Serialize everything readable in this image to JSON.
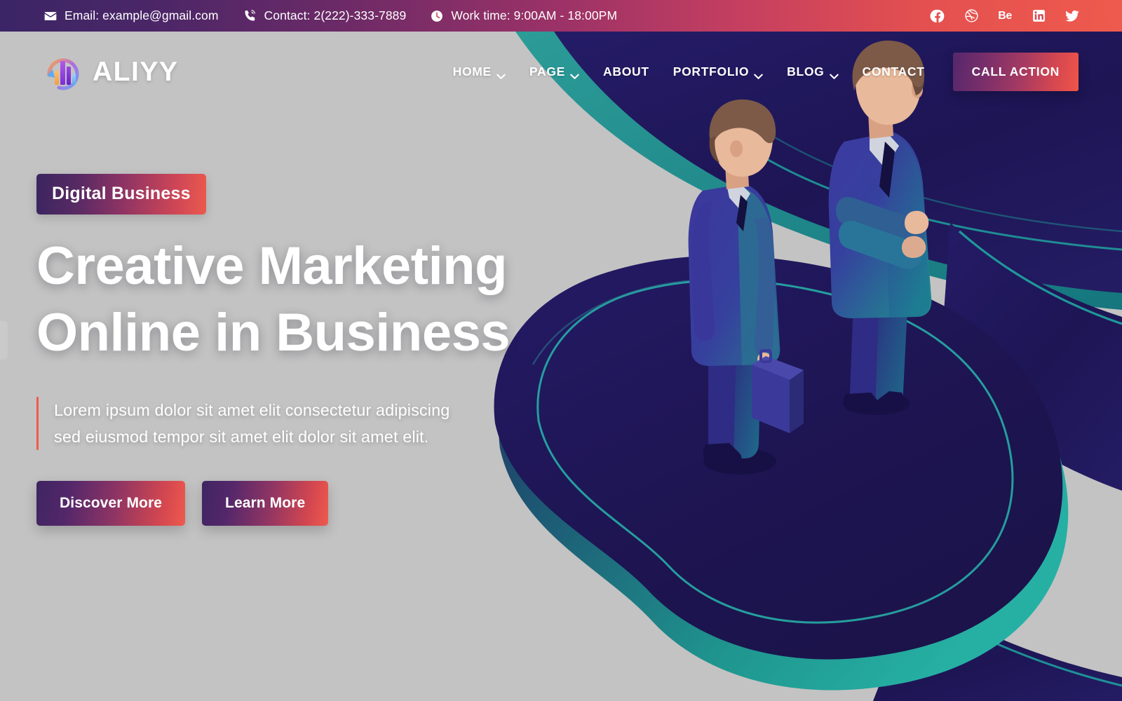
{
  "topbar": {
    "email": {
      "icon": "envelope-icon",
      "text": "Email: example@gmail.com"
    },
    "contact": {
      "icon": "phone-icon",
      "text": "Contact: 2(222)-333-7889"
    },
    "worktime": {
      "icon": "clock-icon",
      "text": "Work time: 9:00AM - 18:00PM"
    },
    "socials": [
      {
        "name": "facebook-icon",
        "label": "Facebook"
      },
      {
        "name": "dribbble-icon",
        "label": "Dribbble"
      },
      {
        "name": "behance-icon",
        "label": "Be"
      },
      {
        "name": "linkedin-icon",
        "label": "in"
      },
      {
        "name": "twitter-icon",
        "label": "Twitter"
      }
    ]
  },
  "header": {
    "logo_text": "ALIYY",
    "logo_icon": "bar-chart-circular-arrow-logo",
    "nav": [
      {
        "label": "HOME",
        "has_dropdown": true
      },
      {
        "label": "PAGE",
        "has_dropdown": true
      },
      {
        "label": "ABOUT",
        "has_dropdown": false
      },
      {
        "label": "PORTFOLIO",
        "has_dropdown": true
      },
      {
        "label": "BLOG",
        "has_dropdown": true
      },
      {
        "label": "CONTACT",
        "has_dropdown": false
      }
    ],
    "cta_label": "CALL ACTION"
  },
  "hero": {
    "badge": "Digital Business",
    "title_line1": "Creative Marketing",
    "title_line2": "Online in Business",
    "description_line1": "Lorem ipsum dolor sit amet elit consectetur adipiscing",
    "description_line2": "sed eiusmod tempor sit amet elit dolor sit amet elit.",
    "primary_button": "Discover More",
    "secondary_button": "Learn More"
  },
  "illustration": {
    "alt": "two isometric businessmen standing on a dark blob platform",
    "figures": [
      {
        "name": "businessman-with-briefcase",
        "pose": "standing, side view, holding briefcase"
      },
      {
        "name": "businessman-arms-crossed",
        "pose": "standing, arms crossed"
      }
    ]
  },
  "colors": {
    "background": "#c3c3c3",
    "navy": "#201a5e",
    "navy_dark": "#191247",
    "teal": "#1fa5a0",
    "teal_bright": "#22c3bd",
    "accent_red": "#ef5a4e",
    "accent_purple": "#3b2566",
    "suit_blue": "#3b3a99",
    "skin": "#e8b99a",
    "hair": "#7d5a48"
  }
}
